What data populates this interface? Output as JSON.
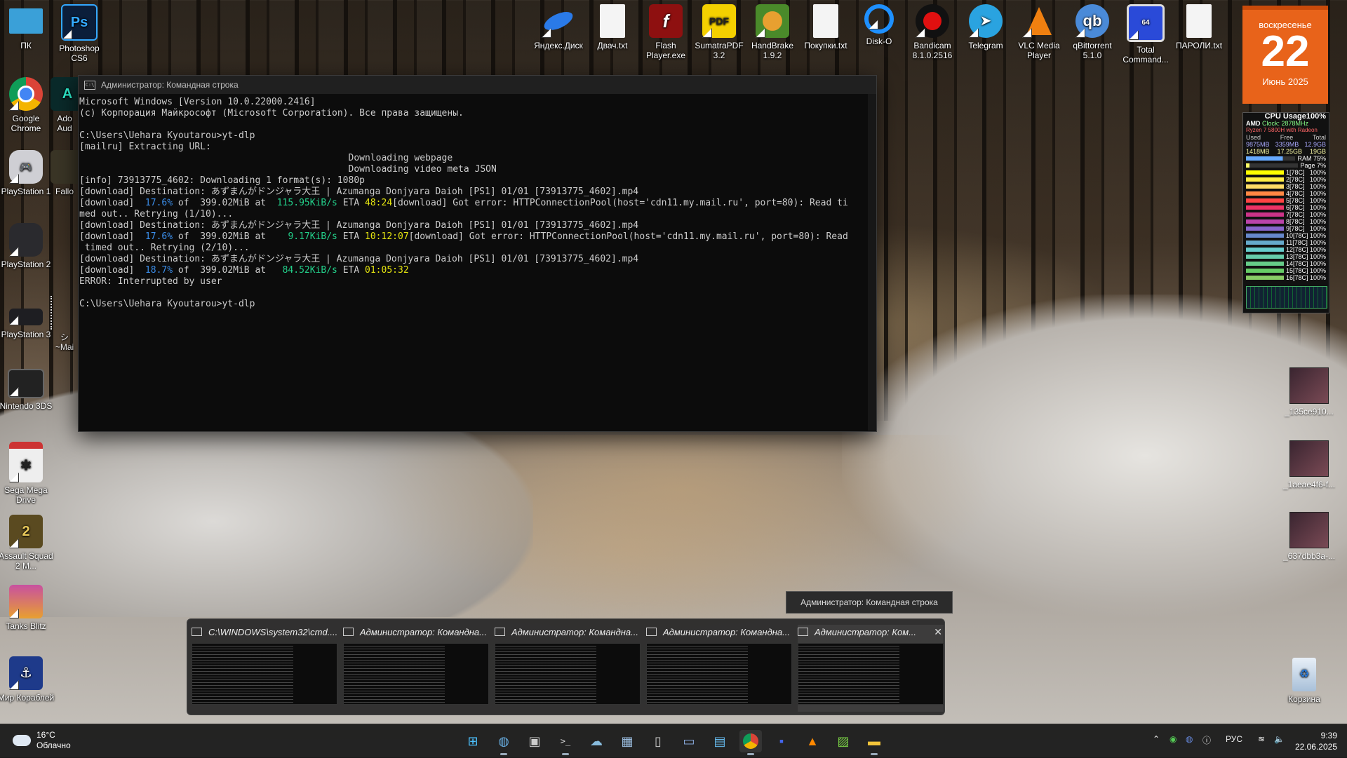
{
  "desktop": {
    "left_icons": [
      {
        "label": "ПК",
        "icon": "pc-icon"
      },
      {
        "label": "Photoshop CS6",
        "icon": "photoshop-icon"
      },
      {
        "label": "Google Chrome",
        "icon": "chrome-icon"
      },
      {
        "label": "Ado Aud",
        "icon": "adobe-audition-icon"
      },
      {
        "label": "PlayStation 1",
        "icon": "playstation1-icon"
      },
      {
        "label": "Fallo",
        "icon": "fallout-icon"
      },
      {
        "label": "PlayStation 2",
        "icon": "playstation2-icon"
      },
      {
        "label": "PlayStation 3",
        "icon": "playstation3-icon"
      },
      {
        "label": "シ ~Mai",
        "icon": "folder-icon"
      },
      {
        "label": "Nintendo 3DS",
        "icon": "nintendo-3ds-icon"
      },
      {
        "label": "Sega Mega Drive",
        "icon": "sega-mega-drive-icon"
      },
      {
        "label": "Assault Squad 2 M...",
        "icon": "assault-squad-icon"
      },
      {
        "label": "Tanks Blitz",
        "icon": "tanks-blitz-icon"
      },
      {
        "label": "Мир Кораблей",
        "icon": "world-of-warships-icon"
      }
    ],
    "top_icons": [
      {
        "label": "Яндекс.Диск",
        "icon": "yandex-disk-icon"
      },
      {
        "label": "Двач.txt",
        "icon": "text-file-icon"
      },
      {
        "label": "Flash Player.exe",
        "icon": "flash-player-icon"
      },
      {
        "label": "SumatraPDF 3.2",
        "icon": "sumatra-pdf-icon"
      },
      {
        "label": "HandBrake 1.9.2",
        "icon": "handbrake-icon"
      },
      {
        "label": "Покупки.txt",
        "icon": "text-file-icon"
      },
      {
        "label": "Disk-O",
        "icon": "disk-o-icon"
      },
      {
        "label": "Bandicam 8.1.0.2516",
        "icon": "bandicam-icon"
      },
      {
        "label": "Telegram",
        "icon": "telegram-icon"
      },
      {
        "label": "VLC Media Player",
        "icon": "vlc-icon"
      },
      {
        "label": "qBittorrent 5.1.0",
        "icon": "qbittorrent-icon"
      },
      {
        "label": "Total Command...",
        "icon": "total-commander-icon"
      },
      {
        "label": "ПАРОЛИ.txt",
        "icon": "text-file-icon"
      }
    ],
    "right_thumbs": [
      {
        "label": "_135ce910..."
      },
      {
        "label": "_1aeae4f6-f..."
      },
      {
        "label": "_637dbb3a-..."
      }
    ],
    "recycle_bin": "Корзина"
  },
  "calendar": {
    "weekday": "воскресенье",
    "day": "22",
    "month": "Июнь 2025",
    "color": "#e8631a"
  },
  "cpu_gadget": {
    "title": "CPU Usage100%",
    "brand": "AMD",
    "clock": "Clock: 2878MHz",
    "model": "Ryzen 7 5800H with Radeon",
    "mem_headers": [
      "Used",
      "Free",
      "Total"
    ],
    "mem_row1": [
      "9875MB",
      "3359MB",
      "12.9GB"
    ],
    "mem_row2": [
      "1418MB",
      "17.25GB",
      "19GB"
    ],
    "ram_label": "RAM",
    "ram_pct": "75%",
    "page_label": "Page",
    "page_pct": "7%",
    "cores": [
      "1[78C]",
      "2[78C]",
      "3[78C]",
      "4[78C]",
      "5[78C]",
      "6[78C]",
      "7[78C]",
      "8[78C]",
      "9[78C]",
      "10[78C]",
      "11[78C]",
      "12[78C]",
      "13[78C]",
      "14[78C]",
      "15[78C]",
      "16[78C]"
    ],
    "core_pct": "100%"
  },
  "console": {
    "title": "Администратор: Командная строка",
    "lines": [
      "Microsoft Windows [Version 10.0.22000.2416]",
      "(c) Корпорация Майкрософт (Microsoft Corporation). Все права защищены.",
      "",
      "C:\\Users\\Uehara Kyoutarou>yt-dlp",
      "[mailru] Extracting URL:",
      "                                                 Downloading webpage",
      "                                                 Downloading video meta JSON",
      "[info] 73913775_4602: Downloading 1 format(s): 1080p",
      "[download] Destination: あずまんがドンジャラ大王 | Azumanga Donjyara Daioh [PS1] 01/01 [73913775_4602].mp4"
    ],
    "dl1": {
      "pre": "[download]  ",
      "pct": "17.6%",
      "mid": " of  399.02MiB at  ",
      "speed": "115.95KiB/s",
      "eta_l": " ETA ",
      "eta": "48:24",
      "post": "[download] Got error: HTTPConnectionPool(host='cdn11.my.mail.ru', port=80): Read ti"
    },
    "dl1_cont": "med out.. Retrying (1/10)...",
    "dest2": "[download] Destination: あずまんがドンジャラ大王 | Azumanga Donjyara Daioh [PS1] 01/01 [73913775_4602].mp4",
    "dl2": {
      "pre": "[download]  ",
      "pct": "17.6%",
      "mid": " of  399.02MiB at    ",
      "speed": "9.17KiB/s",
      "eta_l": " ETA ",
      "eta": "10:12:07",
      "post": "[download] Got error: HTTPConnectionPool(host='cdn11.my.mail.ru', port=80): Read"
    },
    "dl2_cont": " timed out.. Retrying (2/10)...",
    "dest3": "[download] Destination: あずまんがドンジャラ大王 | Azumanga Donjyara Daioh [PS1] 01/01 [73913775_4602].mp4",
    "dl3": {
      "pre": "[download]  ",
      "pct": "18.7%",
      "mid": " of  399.02MiB at   ",
      "speed": "84.52KiB/s",
      "eta_l": " ETA ",
      "eta": "01:05:32"
    },
    "error": "ERROR: Interrupted by user",
    "prompt": "C:\\Users\\Uehara Kyoutarou>yt-dlp"
  },
  "tooltip": "Администратор: Командная строка",
  "previews": [
    {
      "title": "C:\\WINDOWS\\system32\\cmd...."
    },
    {
      "title": "Администратор: Командна..."
    },
    {
      "title": "Администратор: Командна..."
    },
    {
      "title": "Администратор: Командна..."
    },
    {
      "title": "Администратор: Ком..."
    }
  ],
  "taskbar": {
    "weather_temp": "16°C",
    "weather_desc": "Облачно",
    "apps": [
      "start-icon",
      "globe-icon",
      "clapper-icon",
      "terminal-icon",
      "network-icon",
      "calculator-icon",
      "usb-icon",
      "monitor-icon",
      "pictures-icon",
      "chrome-icon",
      "save-icon",
      "vlc-icon",
      "photos-icon",
      "explorer-icon"
    ],
    "lang": "РУС",
    "time": "9:39",
    "date": "22.06.2025"
  }
}
